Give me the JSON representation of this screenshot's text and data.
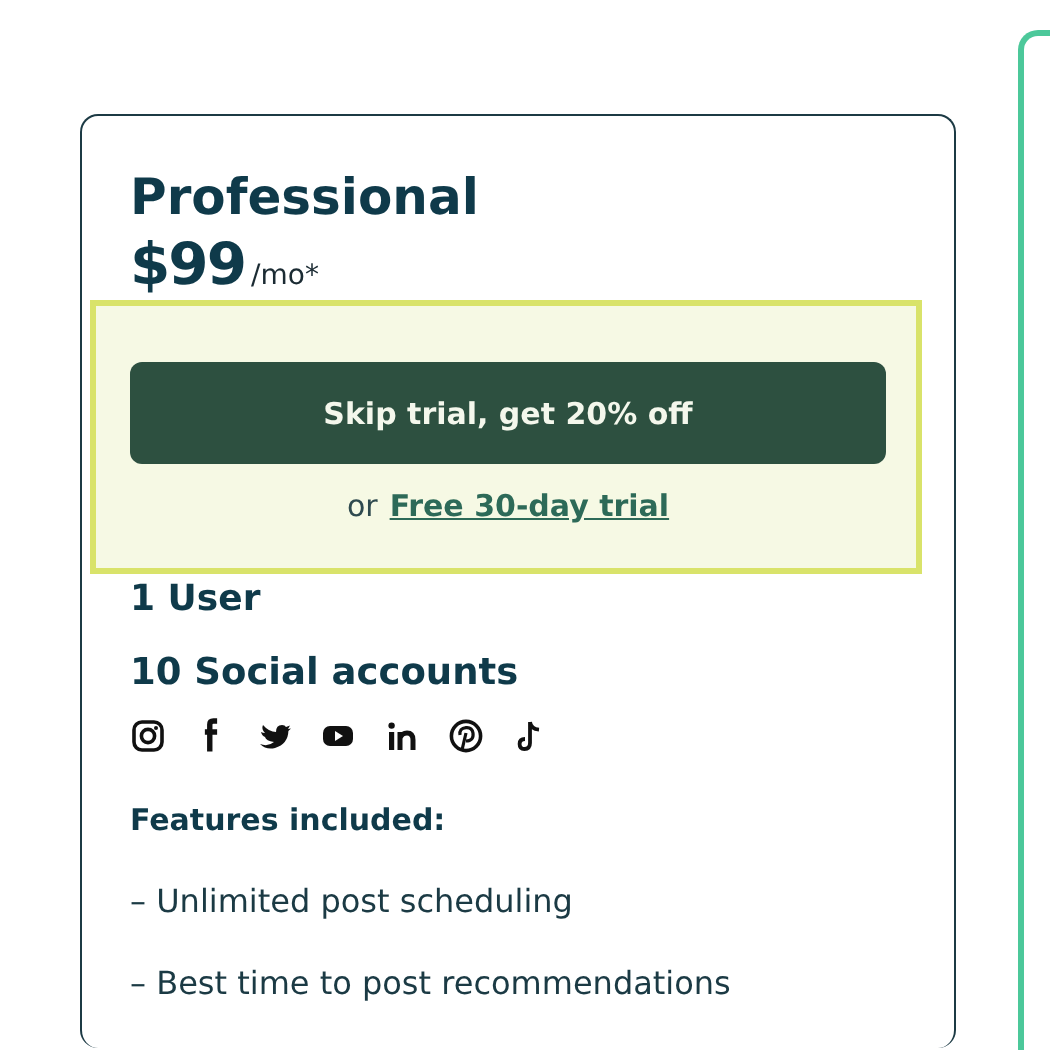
{
  "plan": {
    "title": "Professional",
    "price": "$99",
    "period": "/mo*",
    "offer": {
      "button": "Skip trial, get 20% off",
      "prefix": "or",
      "link": "Free 30-day trial"
    },
    "users": "1 User",
    "accounts": "10 Social accounts",
    "features_heading": "Features included:",
    "features": [
      "– Unlimited post scheduling",
      "– Best time to post recommendations"
    ]
  }
}
